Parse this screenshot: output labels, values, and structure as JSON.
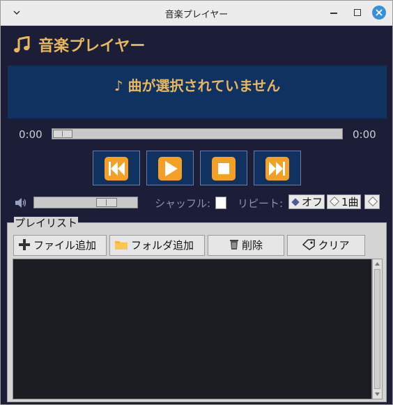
{
  "window": {
    "title": "音楽プレイヤー"
  },
  "header": {
    "icon": "music-note-icon",
    "title": "音楽プレイヤー"
  },
  "now_playing": {
    "text": "♪ 曲が選択されていません"
  },
  "seek": {
    "current_time": "0:00",
    "total_time": "0:00",
    "position": 0
  },
  "controls": [
    "previous-icon",
    "play-icon",
    "stop-icon",
    "next-icon"
  ],
  "volume": {
    "icon": "speaker-icon",
    "level": 0.75
  },
  "shuffle": {
    "label": "シャッフル:",
    "checked": false
  },
  "repeat": {
    "label": "リピート:",
    "options": [
      {
        "label": "オフ",
        "selected": true
      },
      {
        "label": "1曲",
        "selected": false
      },
      {
        "label": "",
        "selected": false
      }
    ]
  },
  "playlist": {
    "title": "プレイリスト",
    "buttons": [
      {
        "icon": "plus-icon",
        "label": "ファイル追加"
      },
      {
        "icon": "folder-icon",
        "label": "フォルダ追加"
      },
      {
        "icon": "trash-icon",
        "label": "削除"
      },
      {
        "icon": "tag-icon",
        "label": "クリア"
      }
    ],
    "items": []
  },
  "colors": {
    "background": "#1b1e36",
    "panel": "#0f3260",
    "accent": "#e8b860",
    "control": "#f4a027"
  }
}
